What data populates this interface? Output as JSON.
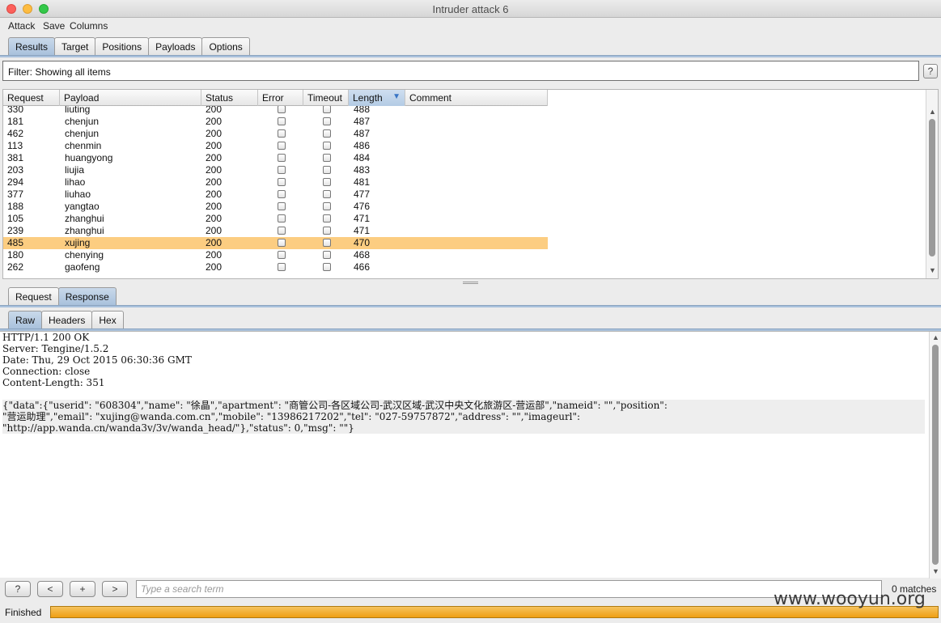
{
  "window": {
    "title": "Intruder attack 6"
  },
  "menu": [
    "Attack",
    "Save",
    "Columns"
  ],
  "main_tabs": [
    "Results",
    "Target",
    "Positions",
    "Payloads",
    "Options"
  ],
  "filter": {
    "text": "Filter: Showing all items",
    "help": "?"
  },
  "table": {
    "columns": [
      "Request",
      "Payload",
      "Status",
      "Error",
      "Timeout",
      "Length",
      "Comment"
    ],
    "sorted_column": "Length",
    "rows": [
      {
        "request": "330",
        "payload": "liuting",
        "status": "200",
        "length": "488",
        "selected": false
      },
      {
        "request": "181",
        "payload": "chenjun",
        "status": "200",
        "length": "487",
        "selected": false
      },
      {
        "request": "462",
        "payload": "chenjun",
        "status": "200",
        "length": "487",
        "selected": false
      },
      {
        "request": "113",
        "payload": "chenmin",
        "status": "200",
        "length": "486",
        "selected": false
      },
      {
        "request": "381",
        "payload": "huangyong",
        "status": "200",
        "length": "484",
        "selected": false
      },
      {
        "request": "203",
        "payload": "liujia",
        "status": "200",
        "length": "483",
        "selected": false
      },
      {
        "request": "294",
        "payload": "lihao",
        "status": "200",
        "length": "481",
        "selected": false
      },
      {
        "request": "377",
        "payload": "liuhao",
        "status": "200",
        "length": "477",
        "selected": false
      },
      {
        "request": "188",
        "payload": "yangtao",
        "status": "200",
        "length": "476",
        "selected": false
      },
      {
        "request": "105",
        "payload": "zhanghui",
        "status": "200",
        "length": "471",
        "selected": false
      },
      {
        "request": "239",
        "payload": "zhanghui",
        "status": "200",
        "length": "471",
        "selected": false
      },
      {
        "request": "485",
        "payload": "xujing",
        "status": "200",
        "length": "470",
        "selected": true
      },
      {
        "request": "180",
        "payload": "chenying",
        "status": "200",
        "length": "468",
        "selected": false
      },
      {
        "request": "262",
        "payload": "gaofeng",
        "status": "200",
        "length": "466",
        "selected": false
      }
    ]
  },
  "reqresp_tabs": [
    "Request",
    "Response"
  ],
  "view_tabs": [
    "Raw",
    "Headers",
    "Hex"
  ],
  "response_lines": [
    "HTTP/1.1 200 OK",
    "Server: Tengine/1.5.2",
    "Date: Thu, 29 Oct 2015 06:30:36 GMT",
    "Connection: close",
    "Content-Length: 351",
    "",
    "{\"data\":{\"userid\": \"608304\",\"name\": \"徐晶\",\"apartment\": \"商管公司-各区域公司-武汉区域-武汉中央文化旅游区-营运部\",\"nameid\": \"\",\"position\":",
    "\"营运助理\",\"email\": \"xujing@wanda.com.cn\",\"mobile\": \"13986217202\",\"tel\": \"027-59757872\",\"address\": \"\",\"imageurl\":",
    "\"http://app.wanda.cn/wanda3v/3v/wanda_head/\"},\"status\": 0,\"msg\": \"\"}"
  ],
  "search": {
    "placeholder": "Type a search term",
    "matches": "0 matches",
    "buttons": [
      "?",
      "<",
      "+",
      ">"
    ]
  },
  "status": {
    "label": "Finished",
    "progress": 1.0
  },
  "watermark": "www.wooyun.org",
  "colors": {
    "selected_row": "#fccd81",
    "progress": "#ef9f14",
    "active_tab": "#a9c1dc"
  }
}
